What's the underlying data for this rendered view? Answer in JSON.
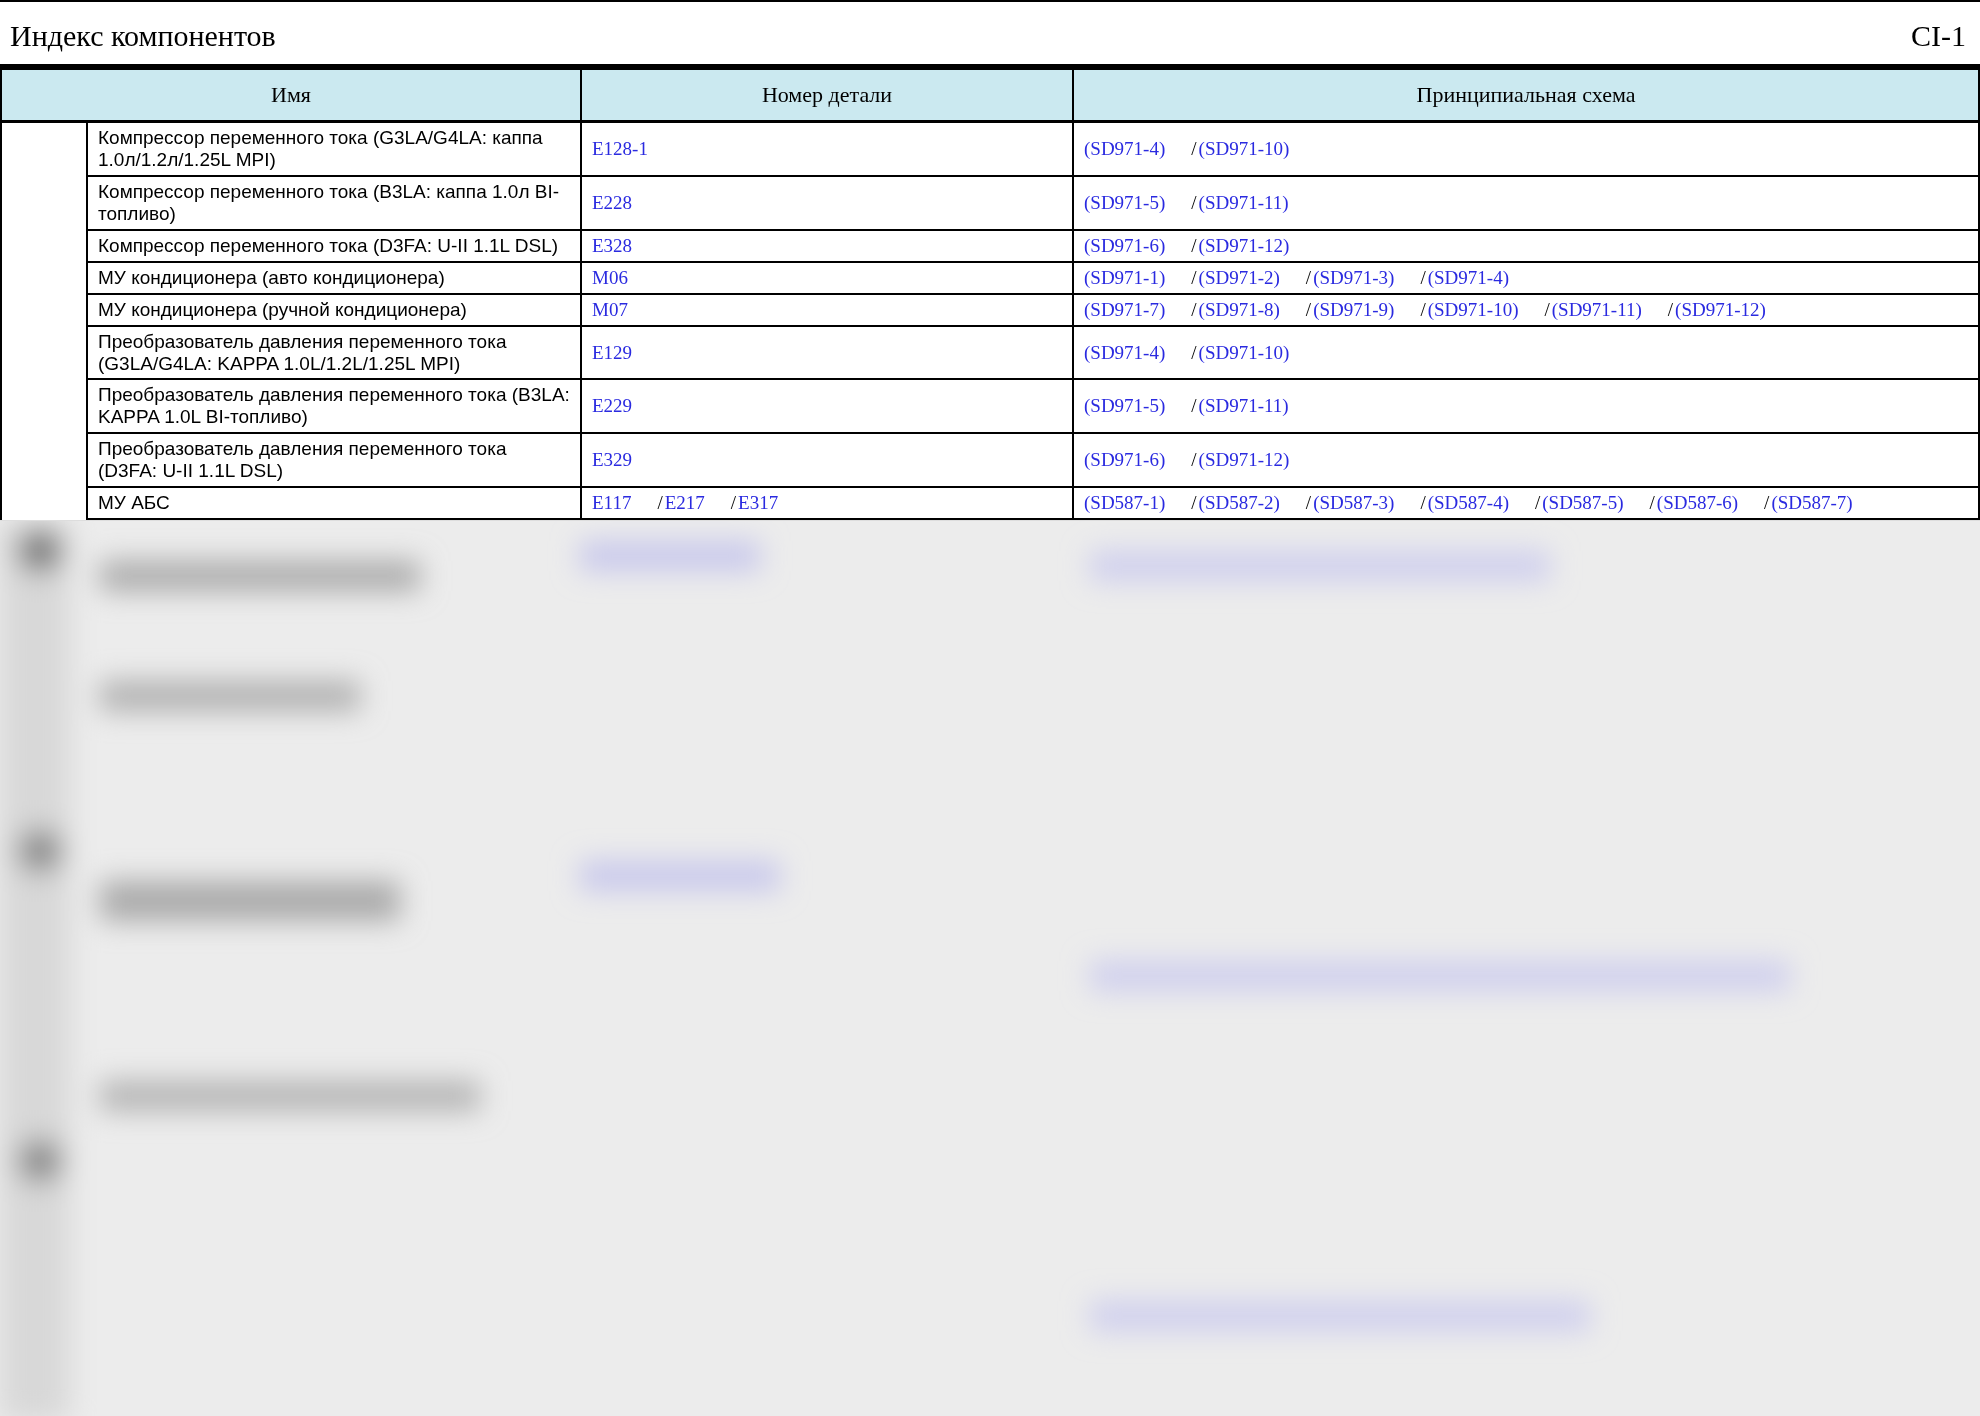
{
  "page": {
    "title": "Индекс компонентов",
    "code": "CI-1"
  },
  "table": {
    "columns": [
      "Имя",
      "Номер детали",
      "Принципиальная схема"
    ],
    "rows": [
      {
        "name": "Компрессор переменного тока (G3LA/G4LA: каппа 1.0л/1.2л/1.25L MPI)",
        "parts": [
          {
            "text": "E128-1"
          }
        ],
        "schemes": [
          {
            "text": "(SD971-4)"
          },
          {
            "sep": "/",
            "text": "(SD971-10)"
          }
        ]
      },
      {
        "name": "Компрессор переменного тока (B3LA: каппа 1.0л BI-топливо)",
        "parts": [
          {
            "text": "E228"
          }
        ],
        "schemes": [
          {
            "text": "(SD971-5)"
          },
          {
            "sep": "/",
            "text": "(SD971-11)"
          }
        ]
      },
      {
        "name": "Компрессор переменного тока (D3FA: U-II 1.1L DSL)",
        "parts": [
          {
            "text": "E328"
          }
        ],
        "schemes": [
          {
            "text": "(SD971-6)"
          },
          {
            "sep": "/",
            "text": "(SD971-12)"
          }
        ]
      },
      {
        "name": "МУ кондиционера (авто кондиционера)",
        "parts": [
          {
            "text": "M06"
          }
        ],
        "schemes": [
          {
            "text": "(SD971-1)"
          },
          {
            "sep": "/",
            "text": "(SD971-2)"
          },
          {
            "sep": "/",
            "text": "(SD971-3)"
          },
          {
            "sep": "/",
            "text": "(SD971-4)"
          }
        ]
      },
      {
        "name": "МУ кондиционера (ручной кондиционера)",
        "parts": [
          {
            "text": "M07"
          }
        ],
        "schemes": [
          {
            "text": "(SD971-7)"
          },
          {
            "sep": "/",
            "text": "(SD971-8)"
          },
          {
            "sep": "/",
            "text": "(SD971-9)"
          },
          {
            "sep": "/",
            "text": "(SD971-10)"
          },
          {
            "sep": "/",
            "text": "(SD971-11)"
          },
          {
            "sep": "/",
            "text": "(SD971-12)"
          }
        ]
      },
      {
        "name": "Преобразователь давления переменного тока (G3LA/G4LA: KAPPA 1.0L/1.2L/1.25L MPI)",
        "parts": [
          {
            "text": "E129"
          }
        ],
        "schemes": [
          {
            "text": "(SD971-4)"
          },
          {
            "sep": "/",
            "text": "(SD971-10)"
          }
        ]
      },
      {
        "name": "Преобразователь давления переменного тока (B3LA: KAPPA 1.0L BI-топливо)",
        "parts": [
          {
            "text": "E229"
          }
        ],
        "schemes": [
          {
            "text": "(SD971-5)"
          },
          {
            "sep": "/",
            "text": "(SD971-11)"
          }
        ]
      },
      {
        "name": "Преобразователь давления переменного тока (D3FA: U-II 1.1L DSL)",
        "parts": [
          {
            "text": "E329"
          }
        ],
        "schemes": [
          {
            "text": "(SD971-6)"
          },
          {
            "sep": "/",
            "text": "(SD971-12)"
          }
        ]
      },
      {
        "name": "МУ АБС",
        "parts": [
          {
            "text": "E117"
          },
          {
            "sep": "/",
            "text": "E217"
          },
          {
            "sep": "/",
            "text": "E317"
          }
        ],
        "schemes": [
          {
            "text": "(SD587-1)"
          },
          {
            "sep": "/",
            "text": "(SD587-2)"
          },
          {
            "sep": "/",
            "text": "(SD587-3)"
          },
          {
            "sep": "/",
            "text": "(SD587-4)"
          },
          {
            "sep": "/",
            "text": "(SD587-5)"
          },
          {
            "sep": "/",
            "text": "(SD587-6)"
          },
          {
            "sep": "/",
            "text": "(SD587-7)"
          }
        ]
      }
    ]
  }
}
